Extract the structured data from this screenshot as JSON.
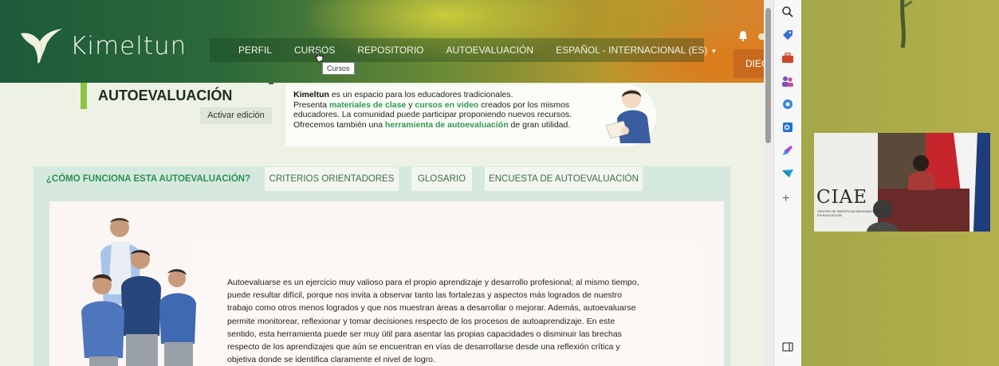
{
  "brand": {
    "name": "Kimeltun"
  },
  "nav": {
    "items": [
      {
        "label": "PERFIL"
      },
      {
        "label": "CURSOS"
      },
      {
        "label": "REPOSITORIO"
      },
      {
        "label": "AUTOEVALUACIÓN"
      },
      {
        "label": "ESPAÑOL - INTERNACIONAL (ES)"
      }
    ],
    "tooltip": "Cursos"
  },
  "user": {
    "label": "DIEC"
  },
  "header": {
    "title": "AUTOEVALUACIÓN",
    "edit_button": "Activar edición"
  },
  "intro": {
    "brand": "Kimeltun",
    "line1_rest": " es un espacio para los educadores tradicionales.",
    "line2_pre": "Presenta ",
    "line2_hl1": "materiales de clase",
    "line2_mid": " y ",
    "line2_hl2": "cursos en video",
    "line2_post": " creados por los mismos",
    "line3": "educadores. La comunidad puede participar proponiendo nuevos recursos.",
    "line4_pre": "Ofrecemos también una ",
    "line4_hl": "herramienta de autoevaluación",
    "line4_post": " de gran utilidad."
  },
  "tabs": [
    {
      "label": "¿CÓMO FUNCIONA ESTA AUTOEVALUACIÓN?",
      "active": true
    },
    {
      "label": "CRITERIOS ORIENTADORES",
      "active": false
    },
    {
      "label": "GLOSARIO",
      "active": false
    },
    {
      "label": "ENCUESTA DE AUTOEVALUACIÓN",
      "active": false
    }
  ],
  "content": {
    "lines": [
      "Autoevaluarse es un ejercicio muy valioso para el propio aprendizaje y desarrollo profesional; al mismo tiempo,",
      "puede resultar difícil, porque nos invita a observar tanto las fortalezas y aspectos más logrados de nuestro",
      "trabajo como otros menos logrados y que nos muestran áreas a desarrollar o mejorar. Además, autoevaluarse",
      "permite monitorear, reflexionar y tomar decisiones respecto de los procesos de autoaprendizaje. En este",
      "sentido, esta herramienta puede ser muy útil para asentar las propias capacidades o disminuir las brechas",
      "respecto de los aprendizajes que aún se encuentran en vías de desarrollarse desde una reflexión crítica y",
      "objetiva donde se identifica claramente el nivel de logro."
    ]
  },
  "sidebar_icons": [
    "search-icon",
    "tag-icon",
    "briefcase-icon",
    "people-icon",
    "copilot-icon",
    "outlook-icon",
    "designer-icon",
    "send-icon",
    "add-icon",
    "split-screen-icon"
  ],
  "video": {
    "logo": "CIAE",
    "subtitle": "CENTRO DE INVESTIGACIÓN AVANZADA EN EDUCACIÓN"
  },
  "colors": {
    "accent_green": "#2d9a52",
    "bar_green": "#8cc63f",
    "user_button": "#c76a1e"
  }
}
